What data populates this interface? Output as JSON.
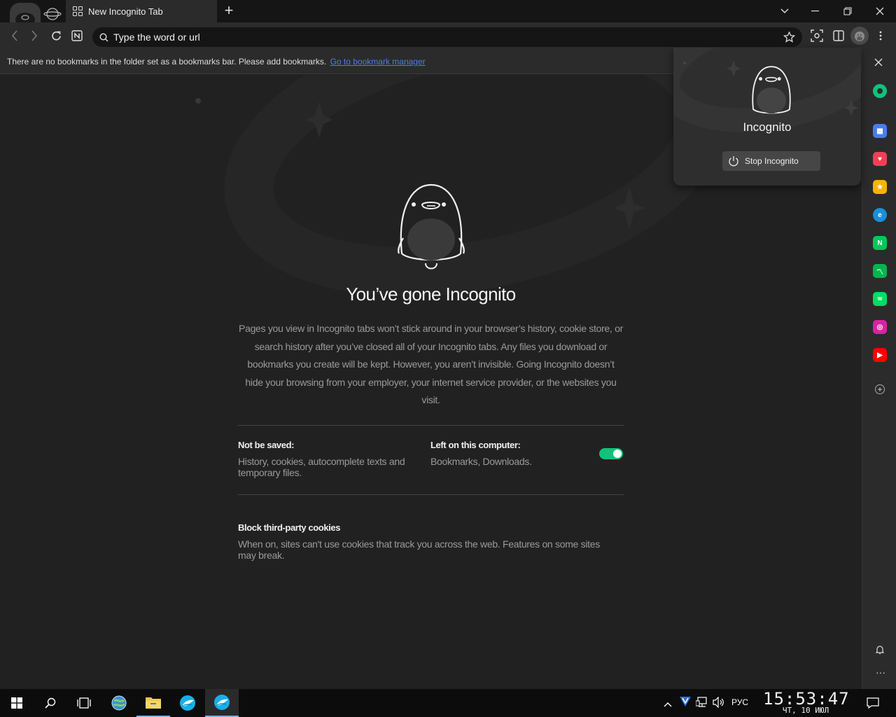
{
  "browser": {
    "tab_title": "New Incognito Tab",
    "address_placeholder": "Type the word or url"
  },
  "bookmarks_bar": {
    "message": "There are no bookmarks in the folder set as a bookmarks bar. Please add bookmarks.",
    "link": "Go to bookmark manager"
  },
  "main": {
    "heading": "You’ve gone Incognito",
    "description": "Pages you view in Incognito tabs won’t stick around in your browser’s history, cookie store, or search history after you’ve closed all of your Incognito tabs. Any files you download or bookmarks you create will be kept. However, you aren’t invisible. Going Incognito doesn’t hide your browsing from your employer, your internet service provider, or the websites you visit.",
    "not_saved_title": "Not be saved:",
    "not_saved_text": "History, cookies, autocomplete texts and temporary files.",
    "left_title": "Left on this computer:",
    "left_text": "Bookmarks, Downloads.",
    "cookies_title": "Block third-party cookies",
    "cookies_text": "When on, sites can't use cookies that track you across the web. Features on some sites may break.",
    "cookies_enabled": true
  },
  "popup": {
    "title": "Incognito",
    "stop_label": "Stop Incognito"
  },
  "sidebar": {
    "items": [
      "green-ring-icon",
      "calendar-icon",
      "pocket-icon",
      "star-icon",
      "edge-icon",
      "naver-icon",
      "chart-icon",
      "webtoon-icon",
      "instagram-icon",
      "youtube-icon"
    ]
  },
  "taskbar": {
    "language": "РУС",
    "time": "15:53:47",
    "date": "ЧТ, 10 ИЮЛ"
  },
  "colors": {
    "accent_toggle": "#10c27a",
    "link": "#4f7fe0"
  }
}
